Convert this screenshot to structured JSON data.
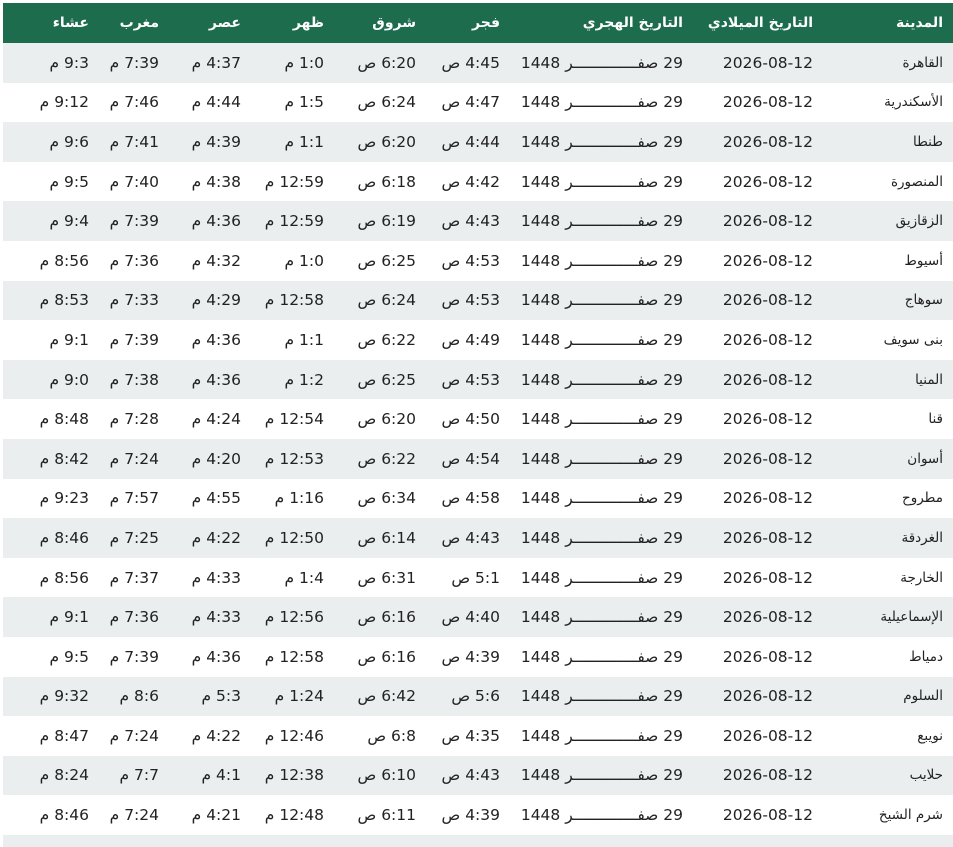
{
  "header": {
    "city": "المدينة",
    "gregorian": "التاريخ الميلادي",
    "hijri": "التاريخ الهجري",
    "fajr": "فجر",
    "sunrise": "شروق",
    "dhuhr": "ظهر",
    "asr": "عصر",
    "maghrib": "مغرب",
    "isha": "عشاء"
  },
  "rows": [
    {
      "city": "القاهرة",
      "gregorian": "2026-08-12",
      "hijri": "29 صفــــــــــــــر 1448",
      "fajr": "4:45 ص",
      "sunrise": "6:20 ص",
      "dhuhr": "1:0 م",
      "asr": "4:37 م",
      "maghrib": "7:39 م",
      "isha": "9:3 م"
    },
    {
      "city": "الأسكندرية",
      "gregorian": "2026-08-12",
      "hijri": "29 صفــــــــــــــر 1448",
      "fajr": "4:47 ص",
      "sunrise": "6:24 ص",
      "dhuhr": "1:5 م",
      "asr": "4:44 م",
      "maghrib": "7:46 م",
      "isha": "9:12 م"
    },
    {
      "city": "طنطا",
      "gregorian": "2026-08-12",
      "hijri": "29 صفــــــــــــــر 1448",
      "fajr": "4:44 ص",
      "sunrise": "6:20 ص",
      "dhuhr": "1:1 م",
      "asr": "4:39 م",
      "maghrib": "7:41 م",
      "isha": "9:6 م"
    },
    {
      "city": "المنصورة",
      "gregorian": "2026-08-12",
      "hijri": "29 صفــــــــــــــر 1448",
      "fajr": "4:42 ص",
      "sunrise": "6:18 ص",
      "dhuhr": "12:59 م",
      "asr": "4:38 م",
      "maghrib": "7:40 م",
      "isha": "9:5 م"
    },
    {
      "city": "الزقازيق",
      "gregorian": "2026-08-12",
      "hijri": "29 صفــــــــــــــر 1448",
      "fajr": "4:43 ص",
      "sunrise": "6:19 ص",
      "dhuhr": "12:59 م",
      "asr": "4:36 م",
      "maghrib": "7:39 م",
      "isha": "9:4 م"
    },
    {
      "city": "أسيوط",
      "gregorian": "2026-08-12",
      "hijri": "29 صفــــــــــــــر 1448",
      "fajr": "4:53 ص",
      "sunrise": "6:25 ص",
      "dhuhr": "1:0 م",
      "asr": "4:32 م",
      "maghrib": "7:36 م",
      "isha": "8:56 م"
    },
    {
      "city": "سوهاج",
      "gregorian": "2026-08-12",
      "hijri": "29 صفــــــــــــــر 1448",
      "fajr": "4:53 ص",
      "sunrise": "6:24 ص",
      "dhuhr": "12:58 م",
      "asr": "4:29 م",
      "maghrib": "7:33 م",
      "isha": "8:53 م"
    },
    {
      "city": "بنى سويف",
      "gregorian": "2026-08-12",
      "hijri": "29 صفــــــــــــــر 1448",
      "fajr": "4:49 ص",
      "sunrise": "6:22 ص",
      "dhuhr": "1:1 م",
      "asr": "4:36 م",
      "maghrib": "7:39 م",
      "isha": "9:1 م"
    },
    {
      "city": "المنيا",
      "gregorian": "2026-08-12",
      "hijri": "29 صفــــــــــــــر 1448",
      "fajr": "4:53 ص",
      "sunrise": "6:25 ص",
      "dhuhr": "1:2 م",
      "asr": "4:36 م",
      "maghrib": "7:38 م",
      "isha": "9:0 م"
    },
    {
      "city": "قنا",
      "gregorian": "2026-08-12",
      "hijri": "29 صفــــــــــــــر 1448",
      "fajr": "4:50 ص",
      "sunrise": "6:20 ص",
      "dhuhr": "12:54 م",
      "asr": "4:24 م",
      "maghrib": "7:28 م",
      "isha": "8:48 م"
    },
    {
      "city": "أسوان",
      "gregorian": "2026-08-12",
      "hijri": "29 صفــــــــــــــر 1448",
      "fajr": "4:54 ص",
      "sunrise": "6:22 ص",
      "dhuhr": "12:53 م",
      "asr": "4:20 م",
      "maghrib": "7:24 م",
      "isha": "8:42 م"
    },
    {
      "city": "مطروح",
      "gregorian": "2026-08-12",
      "hijri": "29 صفــــــــــــــر 1448",
      "fajr": "4:58 ص",
      "sunrise": "6:34 ص",
      "dhuhr": "1:16 م",
      "asr": "4:55 م",
      "maghrib": "7:57 م",
      "isha": "9:23 م"
    },
    {
      "city": "الغردقة",
      "gregorian": "2026-08-12",
      "hijri": "29 صفــــــــــــــر 1448",
      "fajr": "4:43 ص",
      "sunrise": "6:14 ص",
      "dhuhr": "12:50 م",
      "asr": "4:22 م",
      "maghrib": "7:25 م",
      "isha": "8:46 م"
    },
    {
      "city": "الخارجة",
      "gregorian": "2026-08-12",
      "hijri": "29 صفــــــــــــــر 1448",
      "fajr": "5:1 ص",
      "sunrise": "6:31 ص",
      "dhuhr": "1:4 م",
      "asr": "4:33 م",
      "maghrib": "7:37 م",
      "isha": "8:56 م"
    },
    {
      "city": "الإسماعيلية",
      "gregorian": "2026-08-12",
      "hijri": "29 صفــــــــــــــر 1448",
      "fajr": "4:40 ص",
      "sunrise": "6:16 ص",
      "dhuhr": "12:56 م",
      "asr": "4:33 م",
      "maghrib": "7:36 م",
      "isha": "9:1 م"
    },
    {
      "city": "دمياط",
      "gregorian": "2026-08-12",
      "hijri": "29 صفــــــــــــــر 1448",
      "fajr": "4:39 ص",
      "sunrise": "6:16 ص",
      "dhuhr": "12:58 م",
      "asr": "4:36 م",
      "maghrib": "7:39 م",
      "isha": "9:5 م"
    },
    {
      "city": "السلوم",
      "gregorian": "2026-08-12",
      "hijri": "29 صفــــــــــــــر 1448",
      "fajr": "5:6 ص",
      "sunrise": "6:42 ص",
      "dhuhr": "1:24 م",
      "asr": "5:3 م",
      "maghrib": "8:6 م",
      "isha": "9:32 م"
    },
    {
      "city": "نويبع",
      "gregorian": "2026-08-12",
      "hijri": "29 صفــــــــــــــر 1448",
      "fajr": "4:35 ص",
      "sunrise": "6:8 ص",
      "dhuhr": "12:46 م",
      "asr": "4:22 م",
      "maghrib": "7:24 م",
      "isha": "8:47 م"
    },
    {
      "city": "حلايب",
      "gregorian": "2026-08-12",
      "hijri": "29 صفــــــــــــــر 1448",
      "fajr": "4:43 ص",
      "sunrise": "6:10 ص",
      "dhuhr": "12:38 م",
      "asr": "4:1 م",
      "maghrib": "7:7 م",
      "isha": "8:24 م"
    },
    {
      "city": "شرم الشيخ",
      "gregorian": "2026-08-12",
      "hijri": "29 صفــــــــــــــر 1448",
      "fajr": "4:39 ص",
      "sunrise": "6:11 ص",
      "dhuhr": "12:48 م",
      "asr": "4:21 م",
      "maghrib": "7:24 م",
      "isha": "8:46 م"
    }
  ],
  "colors": {
    "header_bg": "#1d6c4e",
    "row_alt_bg": "#eaeeee"
  }
}
